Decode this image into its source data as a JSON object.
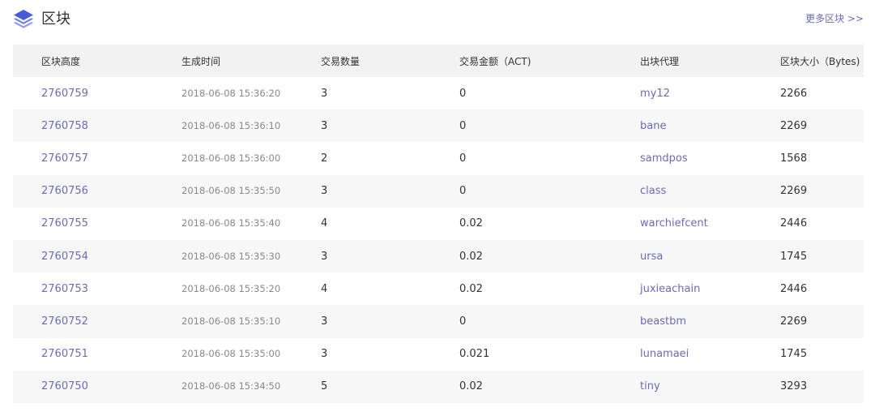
{
  "header": {
    "title": "区块",
    "more_label": "更多区块 >>"
  },
  "table": {
    "columns": [
      "区块高度",
      "生成时间",
      "交易数量",
      "交易金额（ACT)",
      "出块代理",
      "区块大小（Bytes)"
    ],
    "rows": [
      {
        "height": "2760759",
        "time": "2018-06-08 15:36:20",
        "tx_count": "3",
        "tx_amount": "0",
        "producer": "my12",
        "size": "2266"
      },
      {
        "height": "2760758",
        "time": "2018-06-08 15:36:10",
        "tx_count": "3",
        "tx_amount": "0",
        "producer": "bane",
        "size": "2269"
      },
      {
        "height": "2760757",
        "time": "2018-06-08 15:36:00",
        "tx_count": "2",
        "tx_amount": "0",
        "producer": "samdpos",
        "size": "1568"
      },
      {
        "height": "2760756",
        "time": "2018-06-08 15:35:50",
        "tx_count": "3",
        "tx_amount": "0",
        "producer": "class",
        "size": "2269"
      },
      {
        "height": "2760755",
        "time": "2018-06-08 15:35:40",
        "tx_count": "4",
        "tx_amount": "0.02",
        "producer": "warchiefcent",
        "size": "2446"
      },
      {
        "height": "2760754",
        "time": "2018-06-08 15:35:30",
        "tx_count": "3",
        "tx_amount": "0.02",
        "producer": "ursa",
        "size": "1745"
      },
      {
        "height": "2760753",
        "time": "2018-06-08 15:35:20",
        "tx_count": "4",
        "tx_amount": "0.02",
        "producer": "juxieachain",
        "size": "2446"
      },
      {
        "height": "2760752",
        "time": "2018-06-08 15:35:10",
        "tx_count": "3",
        "tx_amount": "0",
        "producer": "beastbm",
        "size": "2269"
      },
      {
        "height": "2760751",
        "time": "2018-06-08 15:35:00",
        "tx_count": "3",
        "tx_amount": "0.021",
        "producer": "lunamaei",
        "size": "1745"
      },
      {
        "height": "2760750",
        "time": "2018-06-08 15:34:50",
        "tx_count": "5",
        "tx_amount": "0.02",
        "producer": "tiny",
        "size": "3293"
      }
    ]
  },
  "colors": {
    "accent": "#6c6cb3",
    "icon": "#4a5bd8",
    "header_bg": "#f2f2f2",
    "stripe_bg": "#f7f7f7"
  },
  "icons": {
    "title_icon": "layers-icon"
  }
}
